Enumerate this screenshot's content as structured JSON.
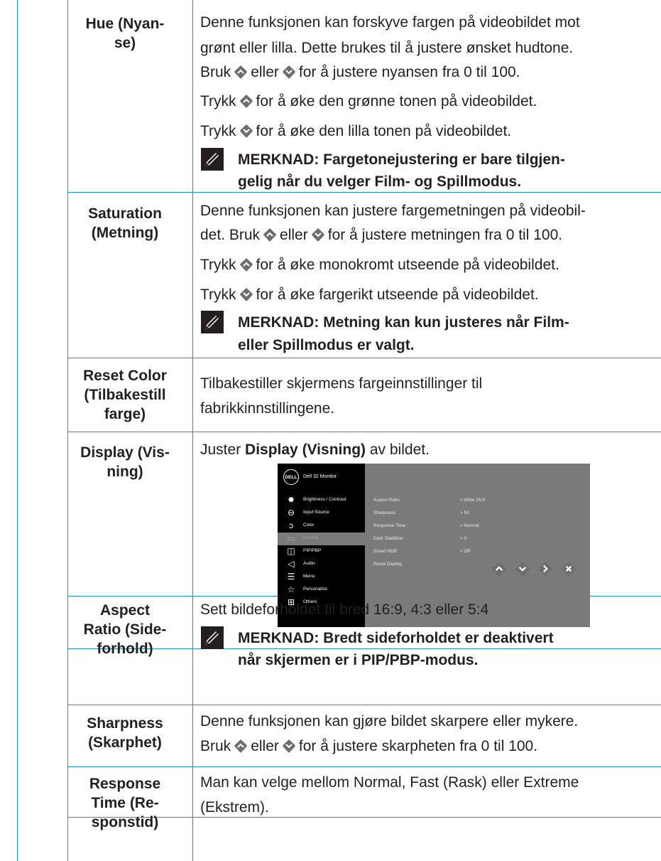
{
  "colors": {
    "rule": "#1e8fc9",
    "button": "#6d6e71",
    "text": "#231f20"
  },
  "rows": {
    "hue": {
      "label_1": "Hue (Nyan-",
      "label_2": "se)",
      "line_1": "Denne funksjonen kan forskyve fargen på videobildet mot",
      "line_2": "grønt eller lilla. Dette brukes til å justere ønsket hudtone.",
      "line_3_a": "Bruk",
      "line_3_b": "eller",
      "line_3_c": "for å justere nyansen fra 0 til 100.",
      "press_up_a": "Trykk",
      "press_up_b": "for å øke den grønne tonen på videobildet.",
      "press_down_a": "Trykk",
      "press_down_b": "for å øke den lilla tonen på videobildet.",
      "note_1": "MERKNAD: Fargetonejustering er bare tilgjen-",
      "note_2": "gelig når du velger Film- og Spillmodus."
    },
    "saturation": {
      "label_1": "Saturation",
      "label_2": "(Metning)",
      "line_1": "Denne funksjonen kan justere fargemetningen på videobil-",
      "line_2_a": "det. Bruk",
      "line_2_b": "eller",
      "line_2_c": "for å justere metningen fra 0 til 100.",
      "press_up_a": "Trykk",
      "press_up_b": "for å øke monokromt utseende på videobildet.",
      "press_down_a": "Trykk",
      "press_down_b": "for å øke fargerikt utseende på videobildet.",
      "note_1": "MERKNAD: Metning kan kun justeres når Film-",
      "note_2": "eller Spillmodus er valgt."
    },
    "reset_color": {
      "label_1": "Reset Color",
      "label_2": "(Tilbakestill",
      "label_3": "farge)",
      "line_1": "Tilbakestiller skjermens fargeinnstillinger til",
      "line_2": "fabrikkinnstillingene."
    },
    "display": {
      "label_1": "Display (Vis-",
      "label_2": "ning)",
      "line_a": "Juster",
      "line_b": "Display (Visning)",
      "line_c": "av bildet."
    },
    "aspect_ratio": {
      "label_1": "Aspect",
      "label_2": "Ratio (Side-",
      "label_3": "forhold)",
      "line_1": "Sett bildeforholdet til bred 16:9, 4:3 eller 5:4",
      "note_1": "MERKNAD: Bredt sideforholdet er deaktivert",
      "note_2": "når skjermen er i PIP/PBP-modus."
    },
    "sharpness": {
      "label_1": "Sharpness",
      "label_2": "(Skarphet)",
      "line_1": "Denne funksjonen kan gjøre bildet skarpere eller mykere.",
      "line_2_a": "Bruk",
      "line_2_b": "eller",
      "line_2_c": "for å justere skarpheten fra 0 til 100."
    },
    "response_time": {
      "label_1": "Response",
      "label_2": "Time (Re-",
      "label_3": "sponstid)",
      "line_1": "Man kan velge mellom Normal, Fast (Rask) eller Extreme",
      "line_2": "(Ekstrem)."
    }
  },
  "osd": {
    "logo": "DELL",
    "title": "Dell 32 Monitor",
    "menu": [
      {
        "label": "Brightness / Contrast",
        "icon": "sun-icon"
      },
      {
        "label": "Input Source",
        "icon": "input-icon"
      },
      {
        "label": "Color",
        "icon": "color-icon"
      },
      {
        "label": "Display",
        "icon": "monitor-icon",
        "selected": true
      },
      {
        "label": "PIP/PBP",
        "icon": "pip-icon"
      },
      {
        "label": "Audio",
        "icon": "speaker-icon"
      },
      {
        "label": "Menu",
        "icon": "menu-icon"
      },
      {
        "label": "Personalize",
        "icon": "star-icon"
      },
      {
        "label": "Others",
        "icon": "others-icon"
      }
    ],
    "settings": [
      {
        "name": "Aspect Ratio",
        "value": "> Wide 16:9"
      },
      {
        "name": "Sharpness",
        "value": "> 50"
      },
      {
        "name": "Response Time",
        "value": "> Normal"
      },
      {
        "name": "Dark Stabilizer",
        "value": "> 0"
      },
      {
        "name": "Smart HDR",
        "value": "> Off"
      },
      {
        "name": "Reset Display",
        "value": ""
      }
    ]
  }
}
